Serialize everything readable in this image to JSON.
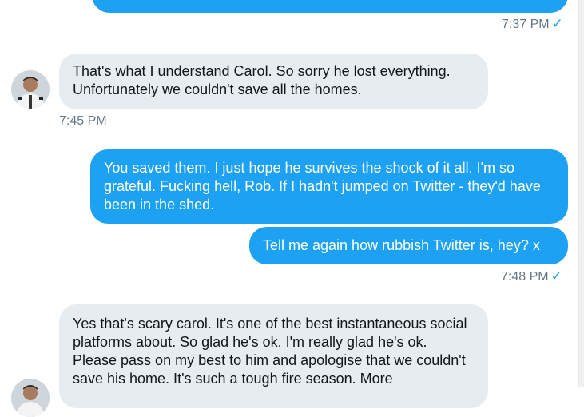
{
  "messages": [
    {
      "id": "m0",
      "direction": "outgoing",
      "text": "",
      "time": "7:37 PM",
      "read": true
    },
    {
      "id": "m1",
      "direction": "incoming",
      "text": "That's what I understand Carol. So sorry he lost everything. Unfortunately we couldn't save all the homes.",
      "time": "7:45 PM"
    },
    {
      "id": "m2",
      "direction": "outgoing",
      "text": "You saved them. I just hope he survives the shock of it all. I'm so grateful. Fucking hell, Rob. If I hadn't jumped on Twitter - they'd have been in the shed."
    },
    {
      "id": "m3",
      "direction": "outgoing",
      "text": "Tell me again how rubbish Twitter is, hey? x",
      "time": "7:48 PM",
      "read": true
    },
    {
      "id": "m4",
      "direction": "incoming",
      "text": "Yes that's scary carol. It's one of the best instantaneous social platforms about. So glad he's ok. I'm really glad he's ok. Please pass on my best to him and apologise that we couldn't save his home. It's such a tough fire season. More"
    }
  ],
  "icons": {
    "read_receipt": "checkmark-icon",
    "avatar": "user-avatar"
  },
  "colors": {
    "outgoing_bubble": "#1da1f2",
    "incoming_bubble": "#e6ecf0",
    "timestamp": "#657786"
  },
  "read_mark": "✓"
}
